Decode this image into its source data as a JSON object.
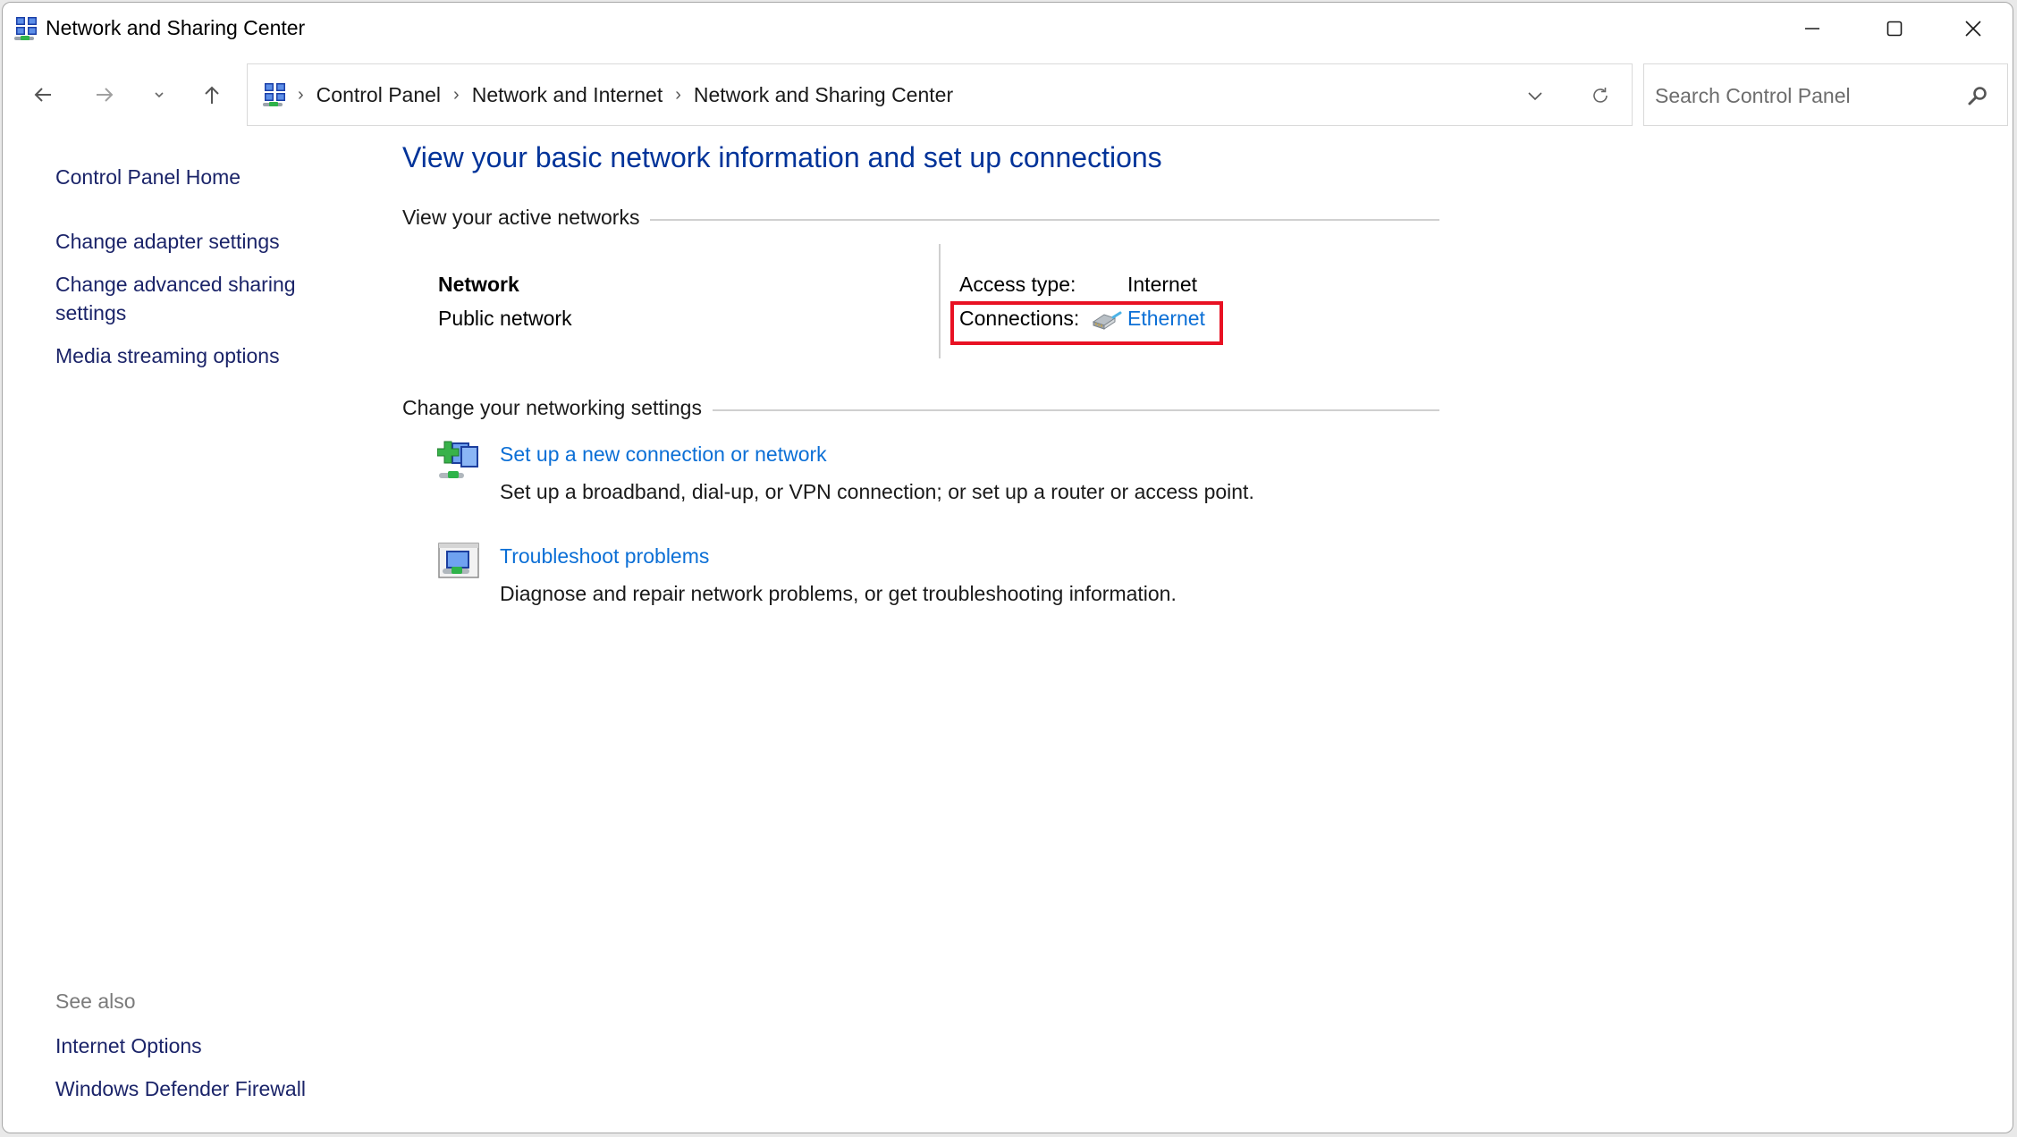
{
  "window": {
    "title": "Network and Sharing Center",
    "controls": {
      "minimize": "Minimize",
      "maximize": "Maximize",
      "close": "Close"
    }
  },
  "nav": {
    "back": "Back",
    "forward": "Forward",
    "recent": "Recent locations",
    "up": "Up"
  },
  "address": {
    "breadcrumbs": [
      "Control Panel",
      "Network and Internet",
      "Network and Sharing Center"
    ]
  },
  "search": {
    "placeholder": "Search Control Panel",
    "value": ""
  },
  "leftpane": {
    "links": [
      "Control Panel Home",
      "Change adapter settings",
      "Change advanced sharing settings",
      "Media streaming options"
    ],
    "see_also_label": "See also",
    "see_also_links": [
      "Internet Options",
      "Windows Defender Firewall"
    ]
  },
  "main": {
    "title": "View your basic network information and set up connections",
    "active_networks_header": "View your active networks",
    "network": {
      "name": "Network",
      "profile": "Public network",
      "access_type_label": "Access type:",
      "access_type_value": "Internet",
      "connections_label": "Connections:",
      "connection_name": "Ethernet"
    },
    "change_settings_header": "Change your networking settings",
    "tasks": [
      {
        "icon": "new-connection-icon",
        "link": "Set up a new connection or network",
        "description": "Set up a broadband, dial-up, or VPN connection; or set up a router or access point."
      },
      {
        "icon": "troubleshoot-icon",
        "link": "Troubleshoot problems",
        "description": "Diagnose and repair network problems, or get troubleshooting information."
      }
    ]
  },
  "colors": {
    "title_blue": "#003399",
    "link_blue": "#0b6fd6",
    "nav_link": "#1b2469",
    "highlight_red": "#e81123"
  }
}
